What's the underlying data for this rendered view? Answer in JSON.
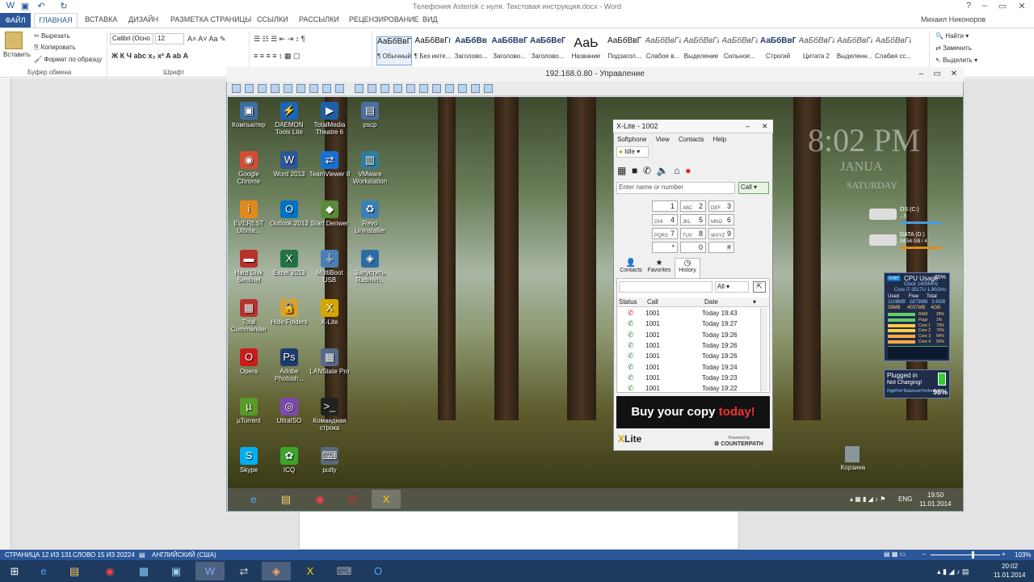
{
  "word": {
    "title": "Телефония Asterisk с нуля. Текстовая инструкция.docx - Word",
    "tabs": [
      "ФАЙЛ",
      "ГЛАВНАЯ",
      "ВСТАВКА",
      "ДИЗАЙН",
      "РАЗМЕТКА СТРАНИЦЫ",
      "ССЫЛКИ",
      "РАССЫЛКИ",
      "РЕЦЕНЗИРОВАНИЕ",
      "ВИД"
    ],
    "user": "Михаил Никоноров",
    "clipboard": {
      "paste": "Вставить",
      "cut": "Вырезать",
      "copy": "Копировать",
      "format": "Формат по образцу",
      "label": "Буфер обмена"
    },
    "font": {
      "name": "Calibri (Осно",
      "size": "12",
      "label": "Шрифт"
    },
    "styles": [
      {
        "p": "АаБбВвГг,",
        "n": "¶ Обычный"
      },
      {
        "p": "АаБбВвГг,",
        "n": "¶ Без инте..."
      },
      {
        "p": "АаБбВв",
        "n": "Заголово..."
      },
      {
        "p": "АаБбВвГ",
        "n": "Заголово..."
      },
      {
        "p": "АаБбВеГ",
        "n": "Заголово..."
      },
      {
        "p": "АаЬ",
        "n": "Название"
      },
      {
        "p": "АаБбВвГ",
        "n": "Подзагол..."
      },
      {
        "p": "АаБбВвГг",
        "n": "Слабое в..."
      },
      {
        "p": "АаБбВвГг",
        "n": "Выделение"
      },
      {
        "p": "АаБбВвГг",
        "n": "Сильное..."
      },
      {
        "p": "АаБбВвГг,",
        "n": "Строгий"
      },
      {
        "p": "АаБбВвГг",
        "n": "Цитата 2"
      },
      {
        "p": "АаБбВвГг",
        "n": "Выделенн..."
      },
      {
        "p": "АаБбВвГг",
        "n": "Слабая сс..."
      }
    ],
    "editing": {
      "find": "Найти",
      "replace": "Заменить",
      "select": "Выделить"
    },
    "status": {
      "page": "СТРАНИЦА 12 ИЗ 131",
      "words": "СЛОВО 15 ИЗ 20224",
      "lang": "АНГЛИЙСКИЙ (США)",
      "zoom": "103%"
    }
  },
  "remote": {
    "title": "192.168.0.80 - Управление"
  },
  "desktop": {
    "icons": [
      {
        "l": "Компьютер",
        "c": "#3b6ea5",
        "g": "▣"
      },
      {
        "l": "DAEMON Tools Lite",
        "c": "#1d63b8",
        "g": "⚡"
      },
      {
        "l": "TotalMedia Theatre 6",
        "c": "#1f5fa8",
        "g": "▶"
      },
      {
        "l": "pscp",
        "c": "#4a6fa0",
        "g": "▤"
      },
      {
        "l": "Google Chrome",
        "c": "#d64c33",
        "g": "◉"
      },
      {
        "l": "Word 2013",
        "c": "#2b579a",
        "g": "W"
      },
      {
        "l": "TeamViewer 8",
        "c": "#1b6fd1",
        "g": "⇄"
      },
      {
        "l": "VMware Workstation",
        "c": "#2e7d9f",
        "g": "▥"
      },
      {
        "l": "EVEREST Ultima...",
        "c": "#e08a1e",
        "g": "i"
      },
      {
        "l": "Outlook 2013",
        "c": "#0072c6",
        "g": "O"
      },
      {
        "l": "Start Denwer",
        "c": "#5a8a3a",
        "g": "◆"
      },
      {
        "l": "Revo Uninstaller",
        "c": "#3a7fb8",
        "g": "♻"
      },
      {
        "l": "Hard Disk Sentinel",
        "c": "#b8322a",
        "g": "▬"
      },
      {
        "l": "Excel 2013",
        "c": "#217346",
        "g": "X"
      },
      {
        "l": "MultiBoot USB",
        "c": "#4a7fb8",
        "g": "⏚"
      },
      {
        "l": "Запустить Radmin...",
        "c": "#2b6ca8",
        "g": "◈"
      },
      {
        "l": "Total Commander",
        "c": "#b83030",
        "g": "▦"
      },
      {
        "l": "Hide Folders",
        "c": "#d8a030",
        "g": "🔒"
      },
      {
        "l": "X-Lite",
        "c": "#d6a600",
        "g": "X"
      },
      {
        "l": "",
        "c": "transparent",
        "g": ""
      },
      {
        "l": "Opera",
        "c": "#cc1b1b",
        "g": "O"
      },
      {
        "l": "Adobe Photosh...",
        "c": "#1c3b6e",
        "g": "Ps"
      },
      {
        "l": "LANState Pro",
        "c": "#556a8a",
        "g": "▦"
      },
      {
        "l": "",
        "c": "transparent",
        "g": ""
      },
      {
        "l": "µTorrent",
        "c": "#5a9a2a",
        "g": "µ"
      },
      {
        "l": "UltraISO",
        "c": "#7a4ab0",
        "g": "◎"
      },
      {
        "l": "Командная строка",
        "c": "#222",
        "g": ">_"
      },
      {
        "l": "",
        "c": "transparent",
        "g": ""
      },
      {
        "l": "Skype",
        "c": "#00aff0",
        "g": "S"
      },
      {
        "l": "ICQ",
        "c": "#3aa52a",
        "g": "✿"
      },
      {
        "l": "putty",
        "c": "#5a6a7a",
        "g": "⌨"
      }
    ],
    "clock": {
      "time": "8:02 PM",
      "month": "JANUA",
      "day": "SATURDAY"
    },
    "disks": [
      {
        "n": "OS (C:)",
        "v": "...5"
      },
      {
        "n": "DATA (D:)",
        "v": "24.54 GB / 4"
      }
    ],
    "cpu": {
      "title": "CPU Usage",
      "pct": "65%",
      "clock": "Clock 1400MHz",
      "model": "Core i7-3517U 1.90GHz",
      "hdr": [
        "Used",
        "Free",
        "Total"
      ],
      "r1": [
        "1108MB",
        "2873MB",
        "3.9GB"
      ],
      "r2": [
        "39MB",
        "4037MB",
        "4GB"
      ],
      "cores": [
        {
          "n": "RAM",
          "v": "28%"
        },
        {
          "n": "Page",
          "v": "1%"
        },
        {
          "n": "Core 1",
          "v": "70%"
        },
        {
          "n": "Core 2",
          "v": "70%"
        },
        {
          "n": "Core 3",
          "v": "64%"
        },
        {
          "n": "Core 4",
          "v": "55%"
        }
      ]
    },
    "battery": {
      "state": "Plugged in",
      "charge": "Not Charging!",
      "plan": "HighPerf Balanced Perform...",
      "pct": "98%"
    },
    "recycle": "Корзина",
    "tray": {
      "lang": "ENG",
      "time": "19:50",
      "date": "11.01.2014"
    }
  },
  "xlite": {
    "title": "X-Lite - 1002",
    "menu": [
      "Softphone",
      "View",
      "Contacts",
      "Help"
    ],
    "status": "Idle",
    "placeholder": "Enter name or number",
    "call": "Call",
    "keys": [
      {
        "n": "1",
        "s": ""
      },
      {
        "n": "2",
        "s": "ABC"
      },
      {
        "n": "3",
        "s": "DEF"
      },
      {
        "n": "4",
        "s": "GHI"
      },
      {
        "n": "5",
        "s": "JKL"
      },
      {
        "n": "6",
        "s": "MNO"
      },
      {
        "n": "7",
        "s": "PQRS"
      },
      {
        "n": "8",
        "s": "TUV"
      },
      {
        "n": "9",
        "s": "WXYZ"
      },
      {
        "n": "*",
        "s": ""
      },
      {
        "n": "0",
        "s": ""
      },
      {
        "n": "#",
        "s": ""
      }
    ],
    "tabs": [
      "Contacts",
      "Favorites",
      "History"
    ],
    "filter": "All",
    "cols": [
      "Status",
      "Call",
      "Date"
    ],
    "rows": [
      {
        "c": "1001",
        "d": "Today 19:43",
        "missed": true
      },
      {
        "c": "1001",
        "d": "Today 19:27"
      },
      {
        "c": "1001",
        "d": "Today 19:26"
      },
      {
        "c": "1001",
        "d": "Today 19:26"
      },
      {
        "c": "1001",
        "d": "Today 19:26"
      },
      {
        "c": "1001",
        "d": "Today 19:24"
      },
      {
        "c": "1001",
        "d": "Today 19:23"
      },
      {
        "c": "1001",
        "d": "Today 19:22"
      }
    ],
    "ad": {
      "a": "Buy your copy ",
      "b": "today!"
    },
    "brand": "Lite",
    "powered": "Powered by",
    "cp": "COUNTERPATH"
  },
  "host": {
    "time": "20:02",
    "date": "11.01.2014"
  }
}
